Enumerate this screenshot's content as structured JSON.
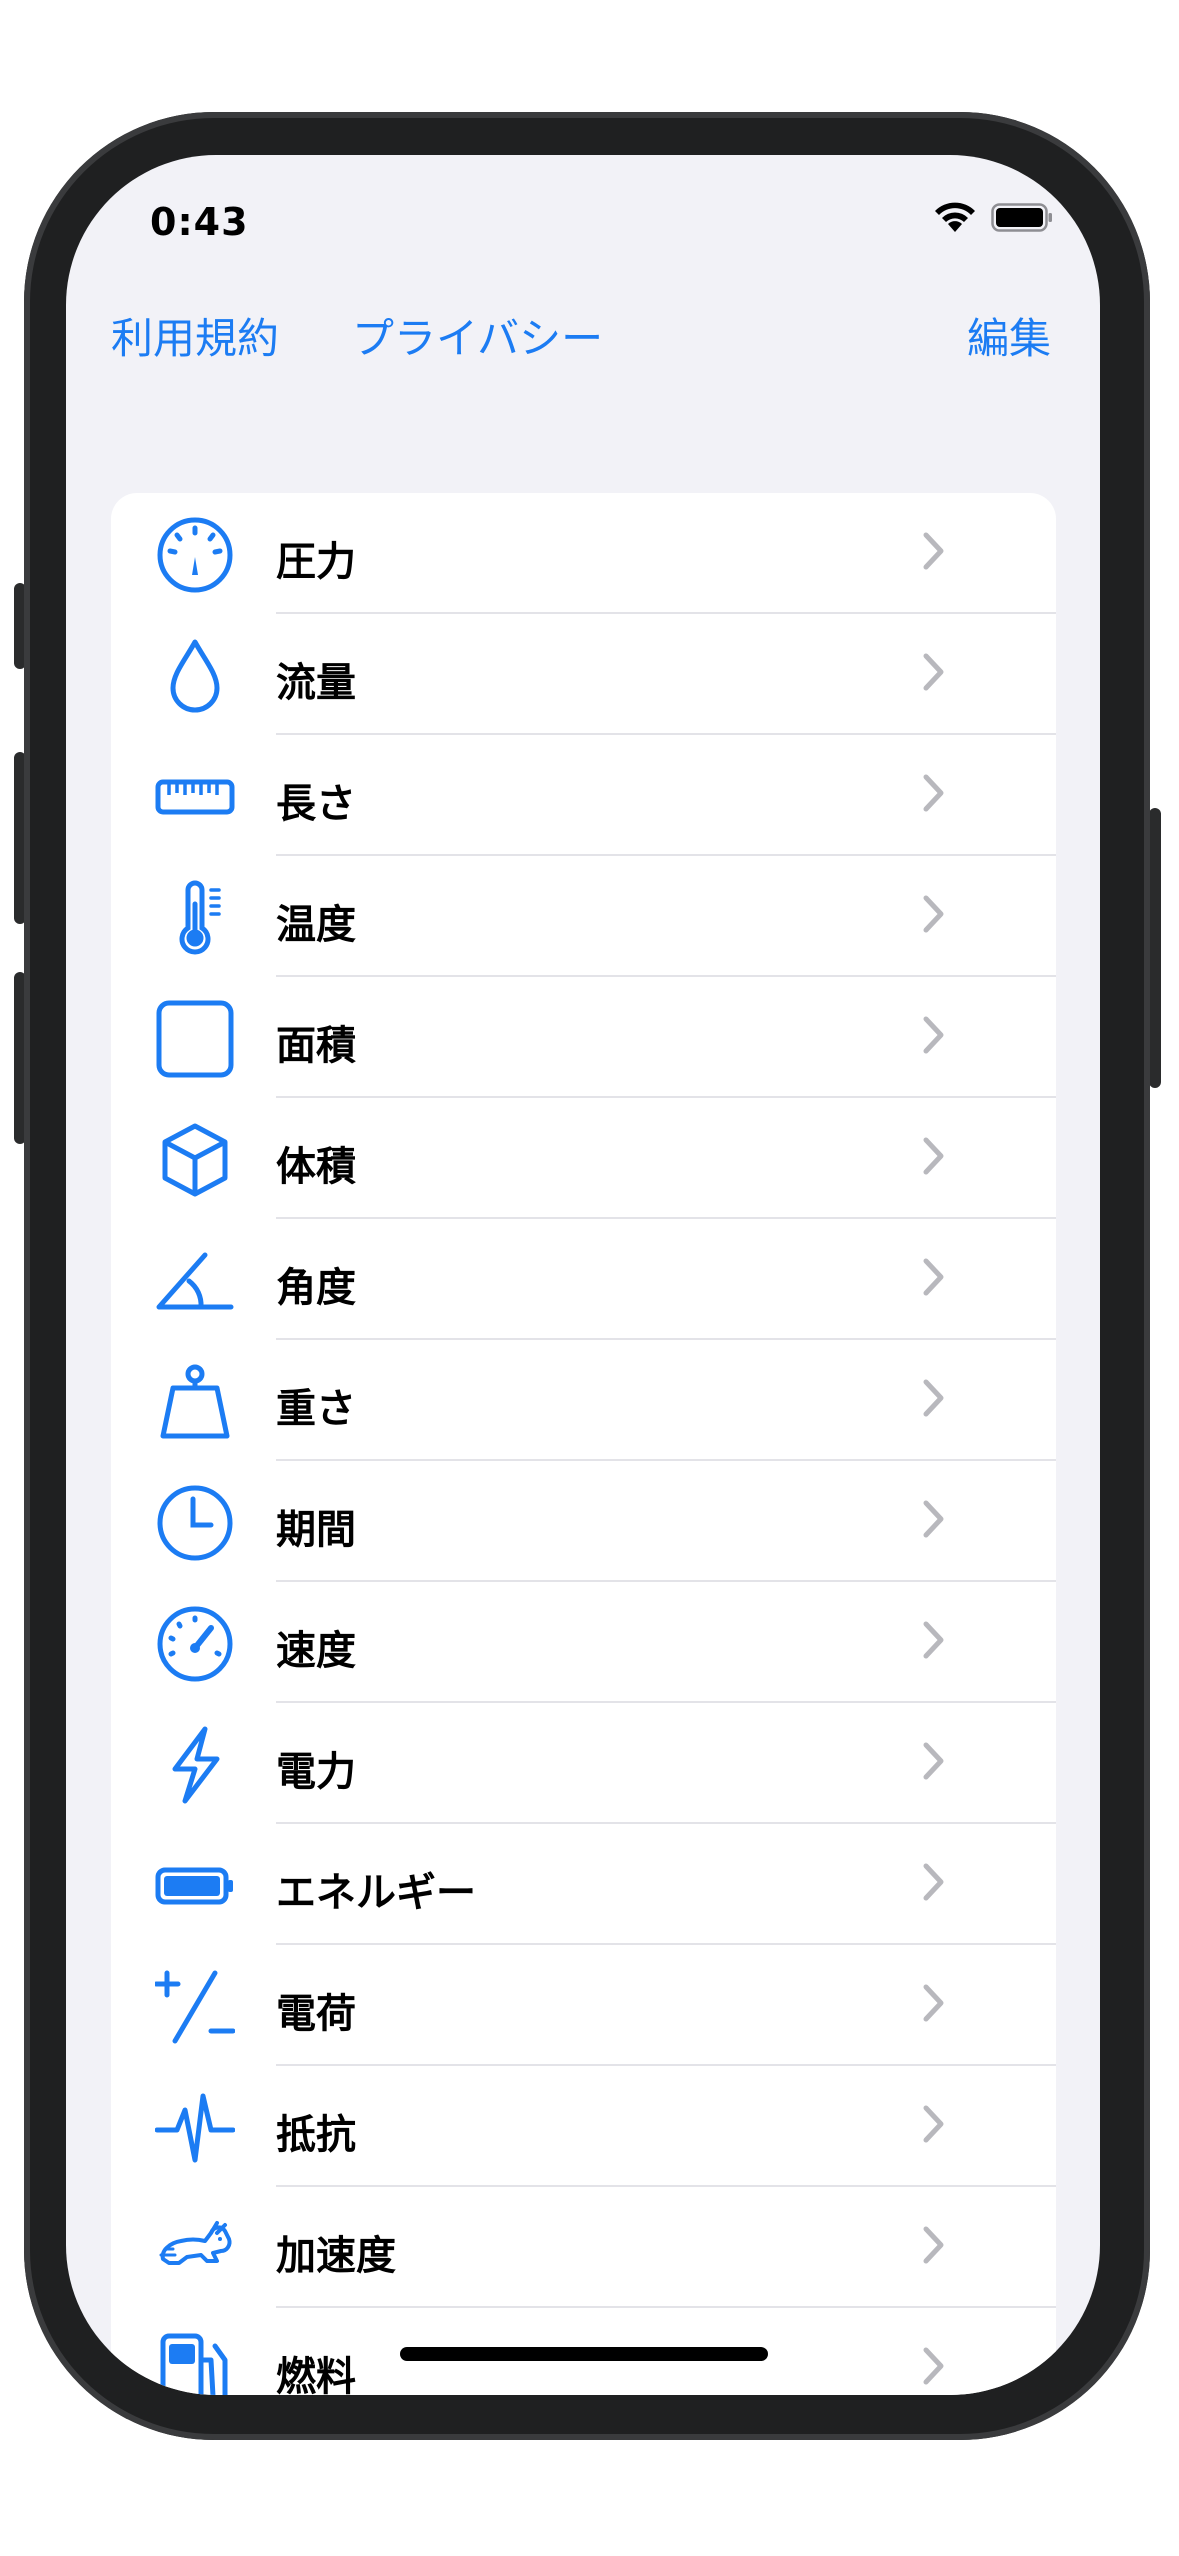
{
  "status_bar": {
    "time": "0:43"
  },
  "nav": {
    "terms": "利用規約",
    "privacy": "プライバシー",
    "edit": "編集"
  },
  "colors": {
    "accent": "#1c7cf3",
    "background": "#f2f2f7",
    "separator": "#e3e3e8",
    "chevron": "#b8b8bd"
  },
  "items": [
    {
      "label": "圧力",
      "icon": "gauge-icon"
    },
    {
      "label": "流量",
      "icon": "drop-icon"
    },
    {
      "label": "長さ",
      "icon": "ruler-icon"
    },
    {
      "label": "温度",
      "icon": "thermometer-icon"
    },
    {
      "label": "面積",
      "icon": "square-icon"
    },
    {
      "label": "体積",
      "icon": "cube-icon"
    },
    {
      "label": "角度",
      "icon": "angle-icon"
    },
    {
      "label": "重さ",
      "icon": "scale-weight-icon"
    },
    {
      "label": "期間",
      "icon": "clock-icon"
    },
    {
      "label": "速度",
      "icon": "speedometer-icon"
    },
    {
      "label": "電力",
      "icon": "bolt-icon"
    },
    {
      "label": "エネルギー",
      "icon": "battery-icon"
    },
    {
      "label": "電荷",
      "icon": "plus-minus-icon"
    },
    {
      "label": "抵抗",
      "icon": "waveform-icon"
    },
    {
      "label": "加速度",
      "icon": "hare-icon"
    },
    {
      "label": "燃料",
      "icon": "fuel-pump-icon"
    }
  ]
}
